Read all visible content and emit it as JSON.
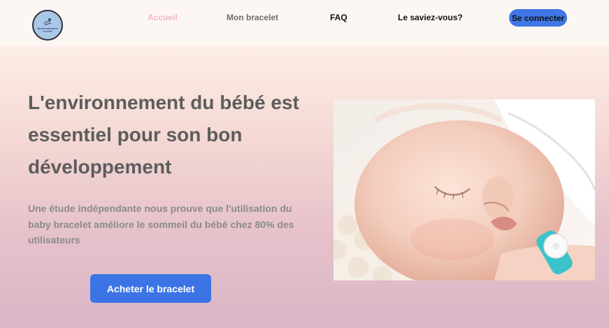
{
  "nav": {
    "logo_text_line1": "INFANTS BRACELET",
    "logo_text_line2": "FACTORY",
    "links": [
      {
        "label": "Accueil",
        "active": true
      },
      {
        "label": "Mon bracelet"
      },
      {
        "label": "FAQ"
      },
      {
        "label": "Le saviez-vous?"
      }
    ],
    "login_label": "Se connecter"
  },
  "hero": {
    "title": "L'environnement du bébé est essentiel pour son bon développement",
    "subtitle": "Une étude indépendante nous prouve que l'utilisation du baby bracelet améliore le sommeil du bébé chez 80% des utilisateurs",
    "cta_label": "Acheter le bracelet",
    "image_alt": "sleeping baby wearing bracelet"
  },
  "colors": {
    "accent": "#3c74e6",
    "active_link": "#f6b3cc",
    "bracelet": "#3bc3c9"
  }
}
